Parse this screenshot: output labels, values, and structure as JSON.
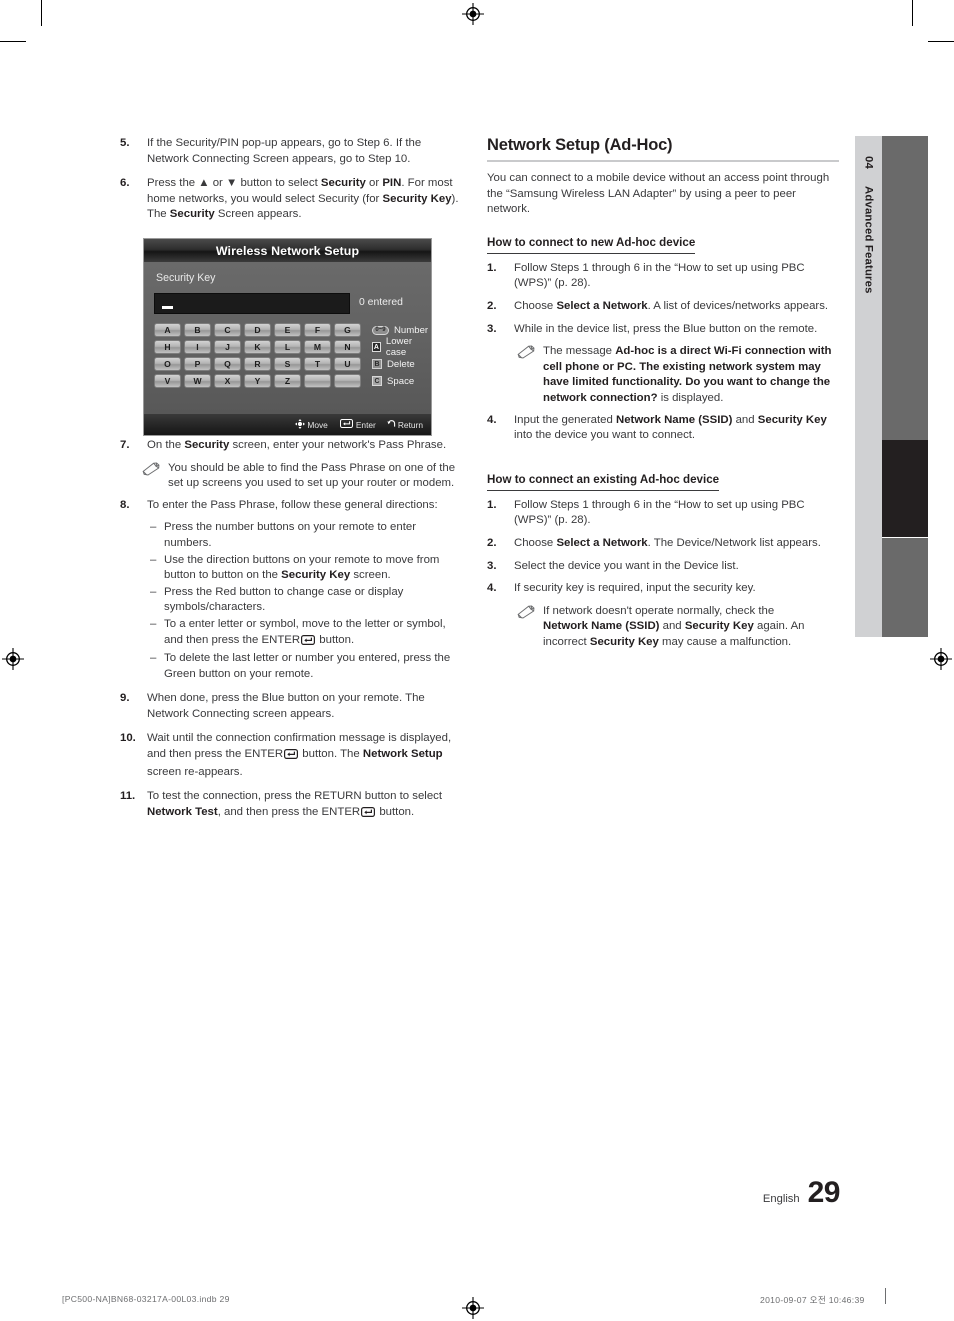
{
  "document": {
    "page_number": "29",
    "language_label": "English",
    "chapter_number": "04",
    "chapter_title": "Advanced Features"
  },
  "left_column": {
    "steps": [
      {
        "num": "5.",
        "text": "If the Security/PIN pop-up appears, go to Step 6. If the Network Connecting Screen appears, go to Step 10."
      },
      {
        "num": "6.",
        "text": "Press the ▲ or ▼ button to select Security or PIN. For most home networks, you would select Security (for Security Key). The Security Screen appears."
      },
      {
        "num": "7.",
        "text": "On the Security screen, enter your network's Pass Phrase."
      },
      {
        "num": "8.",
        "text": "To enter the Pass Phrase, follow these general directions:"
      },
      {
        "num": "9.",
        "text": "When done, press the Blue button on your remote. The Network Connecting screen appears."
      },
      {
        "num": "10.",
        "text": "Wait until the connection confirmation message is displayed, and then press the ENTER button. The Network Setup screen re-appears."
      },
      {
        "num": "11.",
        "text": "To test the connection, press the RETURN button to select Network Test, and then press the ENTER button."
      }
    ],
    "note_step7": "You should be able to find the Pass Phrase on one of the set up screens you used to set up your router or modem.",
    "dash_items": [
      "Press the number buttons on your remote to enter numbers.",
      "Use the direction buttons on your remote to move from button to button on the Security Key screen.",
      "Press the Red button to change case or display symbols/characters.",
      "To a enter letter or symbol, move to the letter or symbol, and then press the ENTER button.",
      "To delete the last letter or number you entered, press the Green button on your remote."
    ]
  },
  "osd": {
    "title": "Wireless Network Setup",
    "field_label": "Security Key",
    "entered_count": "0 entered",
    "keys": [
      "A",
      "B",
      "C",
      "D",
      "E",
      "F",
      "G",
      "H",
      "I",
      "J",
      "K",
      "L",
      "M",
      "N",
      "O",
      "P",
      "Q",
      "R",
      "S",
      "T",
      "U",
      "V",
      "W",
      "X",
      "Y",
      "Z",
      "",
      ""
    ],
    "legend": [
      {
        "badge": "0~9",
        "label": "Number"
      },
      {
        "badge": "A",
        "label": "Lower case"
      },
      {
        "badge": "B",
        "label": "Delete"
      },
      {
        "badge": "C",
        "label": "Space"
      }
    ],
    "footer": [
      {
        "icon": "dpad-icon",
        "label": "Move"
      },
      {
        "icon": "enter-icon",
        "label": "Enter"
      },
      {
        "icon": "return-icon",
        "label": "Return"
      }
    ]
  },
  "right_column": {
    "heading": "Network Setup (Ad-Hoc)",
    "intro": "You can connect to a mobile device without an access point through the “Samsung Wireless LAN Adapter” by using a peer to peer network.",
    "section_new": {
      "heading": "How to connect to new Ad-hoc device",
      "steps": [
        {
          "num": "1.",
          "text": "Follow Steps 1 through 6 in the “How to set up using PBC (WPS)” (p. 28)."
        },
        {
          "num": "2.",
          "text": "Choose Select a Network. A list of devices/networks appears."
        },
        {
          "num": "3.",
          "text": "While in the device list, press the Blue button on the remote."
        },
        {
          "num": "4.",
          "text": "Input the generated Network Name (SSID) and Security Key into the device you want to connect."
        }
      ],
      "note": "The message Ad-hoc is a direct Wi-Fi connection with cell phone or PC. The existing network system may have limited functionality. Do you want to change the network connection? is displayed."
    },
    "section_existing": {
      "heading": "How to connect an existing Ad-hoc device",
      "steps": [
        {
          "num": "1.",
          "text": "Follow Steps 1 through 6 in the “How to set up using PBC (WPS)” (p. 28)."
        },
        {
          "num": "2.",
          "text": "Choose Select a Network. The Device/Network list appears."
        },
        {
          "num": "3.",
          "text": "Select the device you want in the Device list."
        },
        {
          "num": "4.",
          "text": "If security key is required, input the security key."
        }
      ],
      "note": "If network doesn't operate normally, check the Network Name (SSID) and Security Key again. An incorrect Security Key may cause a malfunction."
    }
  },
  "print_footer": {
    "left": "[PC500-NA]BN68-03217A-00L03.indb   29",
    "right": "2010-09-07   오전 10:46:39"
  }
}
